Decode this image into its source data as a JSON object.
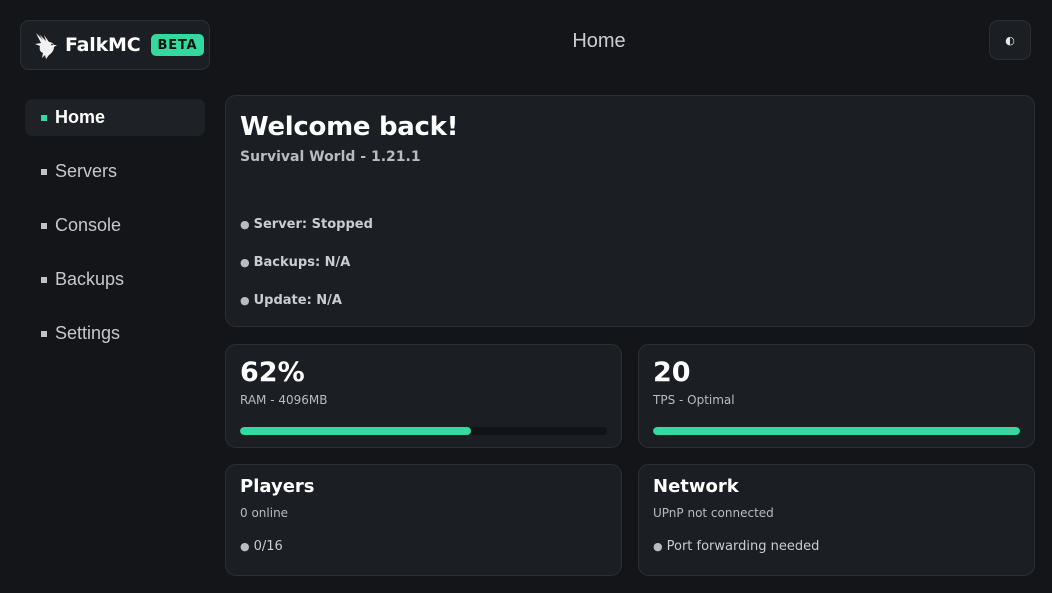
{
  "brand": {
    "name": "FalkMC",
    "badge": "BETA"
  },
  "header": {
    "title": "Home",
    "theme_toggle_glyph": "◐"
  },
  "nav": {
    "items": [
      {
        "label": "Home",
        "active": true
      },
      {
        "label": "Servers",
        "active": false
      },
      {
        "label": "Console",
        "active": false
      },
      {
        "label": "Backups",
        "active": false
      },
      {
        "label": "Settings",
        "active": false
      }
    ]
  },
  "welcome": {
    "title": "Welcome back!",
    "subtitle": "Survival World - 1.21.1",
    "status": [
      "Server: Stopped",
      "Backups: N/A",
      "Update: N/A"
    ]
  },
  "stats": {
    "ram": {
      "value": "62%",
      "label": "RAM - 4096MB",
      "progress": 0.63
    },
    "tps": {
      "value": "20",
      "label": "TPS - Optimal",
      "progress": 1.0
    }
  },
  "players": {
    "title": "Players",
    "subtitle": "0 online",
    "item": "0/16"
  },
  "network": {
    "title": "Network",
    "subtitle": "UPnP not connected",
    "item": "Port forwarding needed"
  },
  "colors": {
    "accent": "#33d99e",
    "background": "#131518",
    "card": "#1b1e22",
    "border": "#2c3036"
  }
}
